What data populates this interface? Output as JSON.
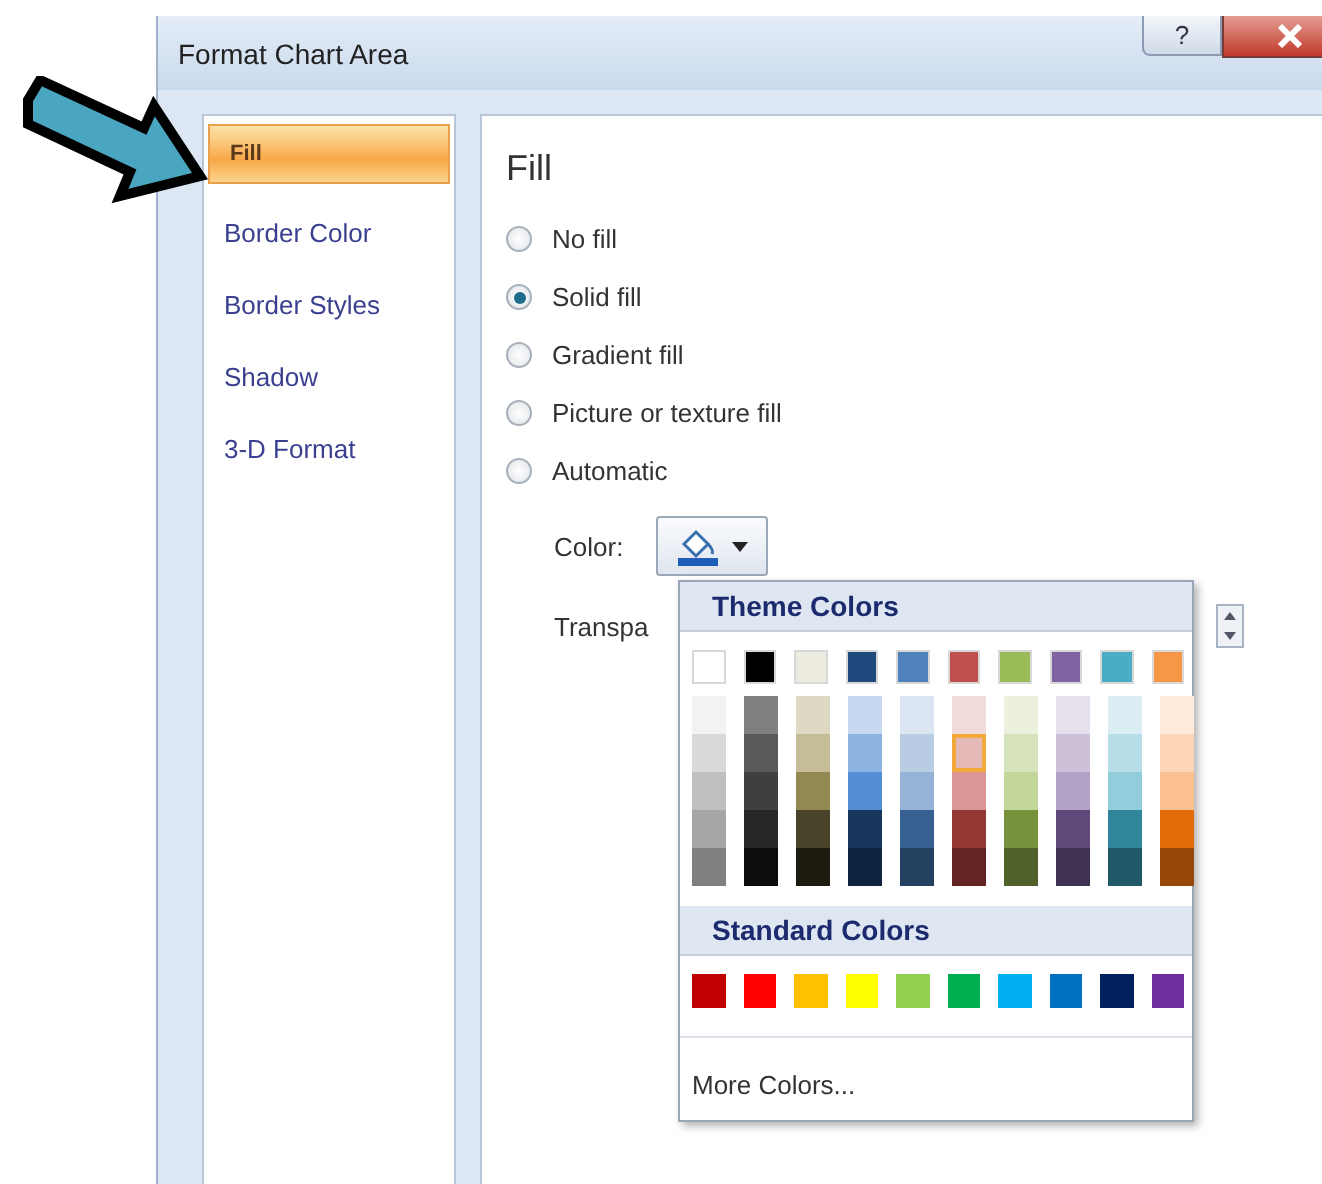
{
  "window": {
    "title": "Format Chart Area",
    "help_button": "?"
  },
  "nav": [
    {
      "label": "Fill",
      "selected": true
    },
    {
      "label": "Border Color",
      "selected": false
    },
    {
      "label": "Border Styles",
      "selected": false
    },
    {
      "label": "Shadow",
      "selected": false
    },
    {
      "label": "3-D Format",
      "selected": false
    }
  ],
  "panel": {
    "heading": "Fill",
    "fill_options": [
      {
        "label": "No fill",
        "selected": false
      },
      {
        "label": "Solid fill",
        "selected": true
      },
      {
        "label": "Gradient fill",
        "selected": false
      },
      {
        "label": "Picture or texture fill",
        "selected": false
      },
      {
        "label": "Automatic",
        "selected": false
      }
    ],
    "color_label": "Color:",
    "transparency_label": "Transpa"
  },
  "color_picker": {
    "theme_heading": "Theme Colors",
    "theme_columns": [
      {
        "base": {
          "color": "#ffffff",
          "selected": false
        },
        "shades": [
          {
            "color": "#f2f2f2",
            "selected": false
          },
          {
            "color": "#d9d9d9",
            "selected": false
          },
          {
            "color": "#bfbfbf",
            "selected": false
          },
          {
            "color": "#a6a6a6",
            "selected": false
          },
          {
            "color": "#808080",
            "selected": false
          }
        ]
      },
      {
        "base": {
          "color": "#000000",
          "selected": false
        },
        "shades": [
          {
            "color": "#7f7f7f",
            "selected": false
          },
          {
            "color": "#595959",
            "selected": false
          },
          {
            "color": "#3f3f3f",
            "selected": false
          },
          {
            "color": "#262626",
            "selected": false
          },
          {
            "color": "#0d0d0d",
            "selected": false
          }
        ]
      },
      {
        "base": {
          "color": "#eeece1",
          "selected": false
        },
        "shades": [
          {
            "color": "#ddd9c3",
            "selected": false
          },
          {
            "color": "#c4bd97",
            "selected": false
          },
          {
            "color": "#938953",
            "selected": false
          },
          {
            "color": "#494429",
            "selected": false
          },
          {
            "color": "#1d1b10",
            "selected": false
          }
        ]
      },
      {
        "base": {
          "color": "#1f497d",
          "selected": false
        },
        "shades": [
          {
            "color": "#c6d9f0",
            "selected": false
          },
          {
            "color": "#8db3e2",
            "selected": false
          },
          {
            "color": "#548dd4",
            "selected": false
          },
          {
            "color": "#17365d",
            "selected": false
          },
          {
            "color": "#0f243e",
            "selected": false
          }
        ]
      },
      {
        "base": {
          "color": "#4f81bd",
          "selected": false
        },
        "shades": [
          {
            "color": "#dbe5f1",
            "selected": false
          },
          {
            "color": "#b8cce4",
            "selected": false
          },
          {
            "color": "#95b3d7",
            "selected": false
          },
          {
            "color": "#366092",
            "selected": false
          },
          {
            "color": "#244061",
            "selected": false
          }
        ]
      },
      {
        "base": {
          "color": "#c0504d",
          "selected": false
        },
        "shades": [
          {
            "color": "#f2dcdb",
            "selected": false
          },
          {
            "color": "#e5b9b7",
            "selected": true
          },
          {
            "color": "#d99694",
            "selected": false
          },
          {
            "color": "#953734",
            "selected": false
          },
          {
            "color": "#632423",
            "selected": false
          }
        ]
      },
      {
        "base": {
          "color": "#9bbb59",
          "selected": false
        },
        "shades": [
          {
            "color": "#ebf1dd",
            "selected": false
          },
          {
            "color": "#d7e3bc",
            "selected": false
          },
          {
            "color": "#c3d69b",
            "selected": false
          },
          {
            "color": "#76923c",
            "selected": false
          },
          {
            "color": "#4f6128",
            "selected": false
          }
        ]
      },
      {
        "base": {
          "color": "#8064a2",
          "selected": false
        },
        "shades": [
          {
            "color": "#e5e0ec",
            "selected": false
          },
          {
            "color": "#ccc1d9",
            "selected": false
          },
          {
            "color": "#b2a2c7",
            "selected": false
          },
          {
            "color": "#5f497a",
            "selected": false
          },
          {
            "color": "#3f3151",
            "selected": false
          }
        ]
      },
      {
        "base": {
          "color": "#4bacc6",
          "selected": false
        },
        "shades": [
          {
            "color": "#dbeef3",
            "selected": false
          },
          {
            "color": "#b7dde8",
            "selected": false
          },
          {
            "color": "#92cddc",
            "selected": false
          },
          {
            "color": "#31859b",
            "selected": false
          },
          {
            "color": "#205867",
            "selected": false
          }
        ]
      },
      {
        "base": {
          "color": "#f79646",
          "selected": false
        },
        "shades": [
          {
            "color": "#fdeada",
            "selected": false
          },
          {
            "color": "#fbd5b5",
            "selected": false
          },
          {
            "color": "#fac08f",
            "selected": false
          },
          {
            "color": "#e36c09",
            "selected": false
          },
          {
            "color": "#974806",
            "selected": false
          }
        ]
      }
    ],
    "standard_heading": "Standard Colors",
    "standard_colors": [
      {
        "color": "#c00000",
        "selected": false
      },
      {
        "color": "#ff0000",
        "selected": false
      },
      {
        "color": "#ffc000",
        "selected": false
      },
      {
        "color": "#ffff00",
        "selected": false
      },
      {
        "color": "#92d050",
        "selected": false
      },
      {
        "color": "#00b050",
        "selected": false
      },
      {
        "color": "#00b0f0",
        "selected": false
      },
      {
        "color": "#0070c0",
        "selected": false
      },
      {
        "color": "#002060",
        "selected": false
      },
      {
        "color": "#7030a0",
        "selected": false
      }
    ],
    "more_colors": "More Colors..."
  }
}
